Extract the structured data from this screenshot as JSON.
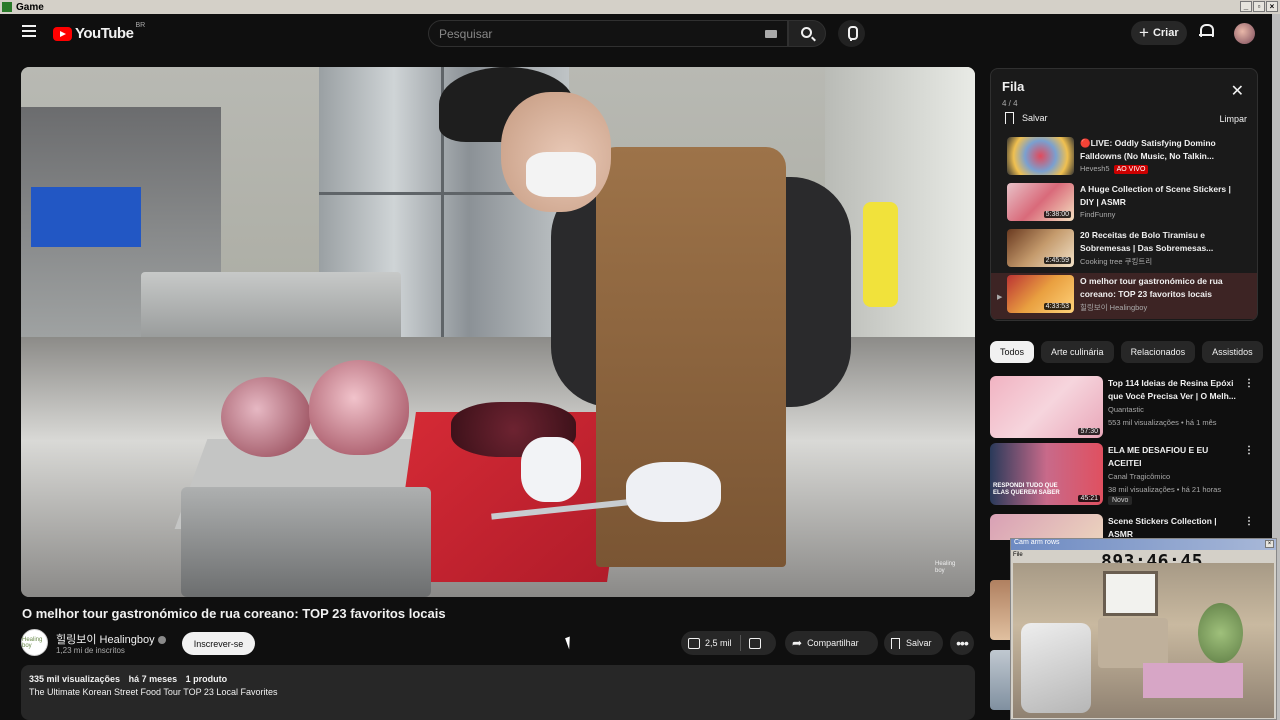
{
  "window": {
    "title": "Game",
    "buttons": [
      "_",
      "▫",
      "×"
    ]
  },
  "header": {
    "logo_text": "YouTube",
    "logo_country": "BR",
    "search_placeholder": "Pesquisar",
    "create_label": "Criar",
    "icons": [
      "menu-icon",
      "keyboard-icon",
      "search-icon",
      "mic-icon",
      "plus-icon",
      "bell-icon",
      "avatar"
    ]
  },
  "video": {
    "title": "O melhor tour gastronómico de rua coreano: TOP 23 favoritos locais",
    "watermark": "Healing boy"
  },
  "channel": {
    "avatar_text": "Healing boy",
    "name": "힐링보이 Healingboy",
    "subscribers": "1,23 mi de inscritos",
    "subscribe_label": "Inscrever-se"
  },
  "actions": {
    "likes": "2,5 mil",
    "share_label": "Compartilhar",
    "save_label": "Salvar",
    "more_label": "•••"
  },
  "description": {
    "views": "335 mil visualizações",
    "age": "há 7 meses",
    "products": "1 produto",
    "line1": "The Ultimate Korean Street Food Tour TOP 23 Local Favorites"
  },
  "queue": {
    "title": "Fila",
    "count": "4 / 4",
    "save_label": "Salvar",
    "clear_label": "Limpar",
    "items": [
      {
        "title": "🔴LIVE: Oddly Satisfying Domino Falldowns (No Music, No Talkin...",
        "channel": "Hevesh5",
        "badge": "AO VIVO",
        "duration": ""
      },
      {
        "title": "A Huge Collection of Scene Stickers | DIY | ASMR",
        "channel": "FindFunny",
        "badge": "",
        "duration": "5:38:00"
      },
      {
        "title": "20 Receitas de Bolo Tiramisu e Sobremesas | Das Sobremesas...",
        "channel": "Cooking tree 쿠킹트리",
        "badge": "",
        "duration": "2:45:59"
      },
      {
        "title": "O melhor tour gastronómico de rua coreano: TOP 23 favoritos locais",
        "channel": "힐링보이 Healingboy",
        "badge": "",
        "duration": "4:33:53",
        "playing": "▶"
      }
    ]
  },
  "chips": [
    "Todos",
    "Arte culinária",
    "Relacionados",
    "Assistidos"
  ],
  "recommendations": [
    {
      "title": "Top 114 Ideias de Resina Epóxi que Você Precisa Ver | O Melh...",
      "channel": "Quantastic",
      "stats": "553 mil visualizações • há 1 mês",
      "badge": "",
      "duration": "57:30"
    },
    {
      "title": "ELA ME DESAFIOU E EU ACEITEI",
      "channel": "Canal Tragicômico",
      "stats": "38 mil visualizações • há 21 horas",
      "badge": "Novo",
      "duration": "45:21",
      "thumb_text": "RESPONDI TUDO QUE ELAS QUEREM SABER"
    },
    {
      "title": "Scene Stickers Collection | ASMR",
      "channel": "",
      "stats": "",
      "badge": "",
      "duration": ""
    }
  ],
  "overlay": {
    "title": "Cam arm rows",
    "menu": "File",
    "timer": "893:46:45",
    "close": "×"
  },
  "colors": {
    "background": "#0f0f0f",
    "accent_red": "#ff0000",
    "chip_selected": "#f1f1f1"
  }
}
